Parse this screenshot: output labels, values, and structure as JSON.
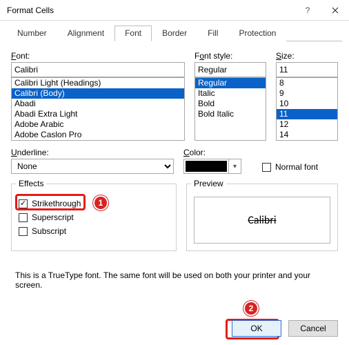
{
  "window": {
    "title": "Format Cells"
  },
  "tabs": [
    "Number",
    "Alignment",
    "Font",
    "Border",
    "Fill",
    "Protection"
  ],
  "labels": {
    "font": "ont:",
    "font_ul": "F",
    "fontstyle": "nt style:",
    "fontstyle_ul": "F",
    "fontstyle_pre": "o",
    "size": "ize:",
    "size_ul": "S",
    "underline": "nderline:",
    "underline_ul": "U",
    "color": "olor:",
    "color_ul": "C",
    "normal": "ormal font",
    "normal_ul": "N",
    "effects": "Effects",
    "strike_pre": "Stri",
    "strike_ul": "k",
    "strike_post": "ethrough",
    "sup_pre": "Sup",
    "sup_ul": "e",
    "sup_post": "rscript",
    "sub_pre": "Su",
    "sub_ul": "b",
    "sub_post": "script",
    "preview": "Preview"
  },
  "font": {
    "value": "Calibri",
    "items": [
      "Calibri Light (Headings)",
      "Calibri (Body)",
      "Abadi",
      "Abadi Extra Light",
      "Adobe Arabic",
      "Adobe Caslon Pro"
    ],
    "selected": 1
  },
  "style": {
    "value": "Regular",
    "items": [
      "Regular",
      "Italic",
      "Bold",
      "Bold Italic"
    ],
    "selected": 0
  },
  "size": {
    "value": "11",
    "items": [
      "8",
      "9",
      "10",
      "11",
      "12",
      "14"
    ],
    "selected": 3
  },
  "underline": {
    "value": "None"
  },
  "color": {
    "value": "#000000"
  },
  "normal_font_checked": false,
  "effects": {
    "strike": true,
    "super": false,
    "sub": false
  },
  "preview_text": "Calibri",
  "description": "This is a TrueType font.  The same font will be used on both your printer and your screen.",
  "buttons": {
    "ok": "OK",
    "cancel": "Cancel"
  },
  "annotations": {
    "1": "1",
    "2": "2"
  }
}
